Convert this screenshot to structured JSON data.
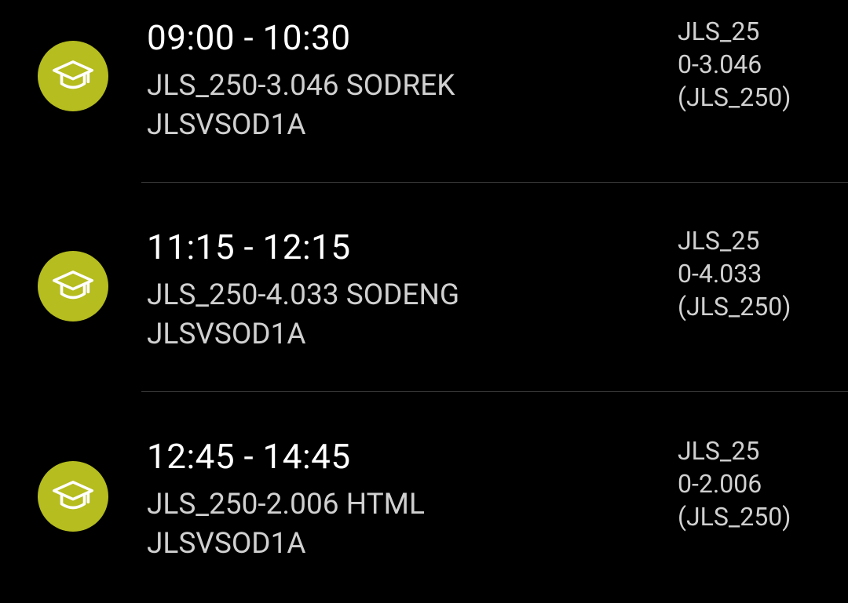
{
  "accent_color": "#b5bd1f",
  "entries": [
    {
      "icon": "graduation-cap-icon",
      "time": "09:00 - 10:30",
      "course": "JLS_250-3.046 SODREK",
      "group": "JLSVSOD1A",
      "location_lines": [
        "JLS_25",
        "0-3.046",
        "(JLS_250)"
      ]
    },
    {
      "icon": "graduation-cap-icon",
      "time": "11:15 - 12:15",
      "course": "JLS_250-4.033 SODENG",
      "group": "JLSVSOD1A",
      "location_lines": [
        "JLS_25",
        "0-4.033",
        "(JLS_250)"
      ]
    },
    {
      "icon": "graduation-cap-icon",
      "time": "12:45 - 14:45",
      "course": "JLS_250-2.006 HTML",
      "group": "JLSVSOD1A",
      "location_lines": [
        "JLS_25",
        "0-2.006",
        "(JLS_250)"
      ]
    }
  ]
}
